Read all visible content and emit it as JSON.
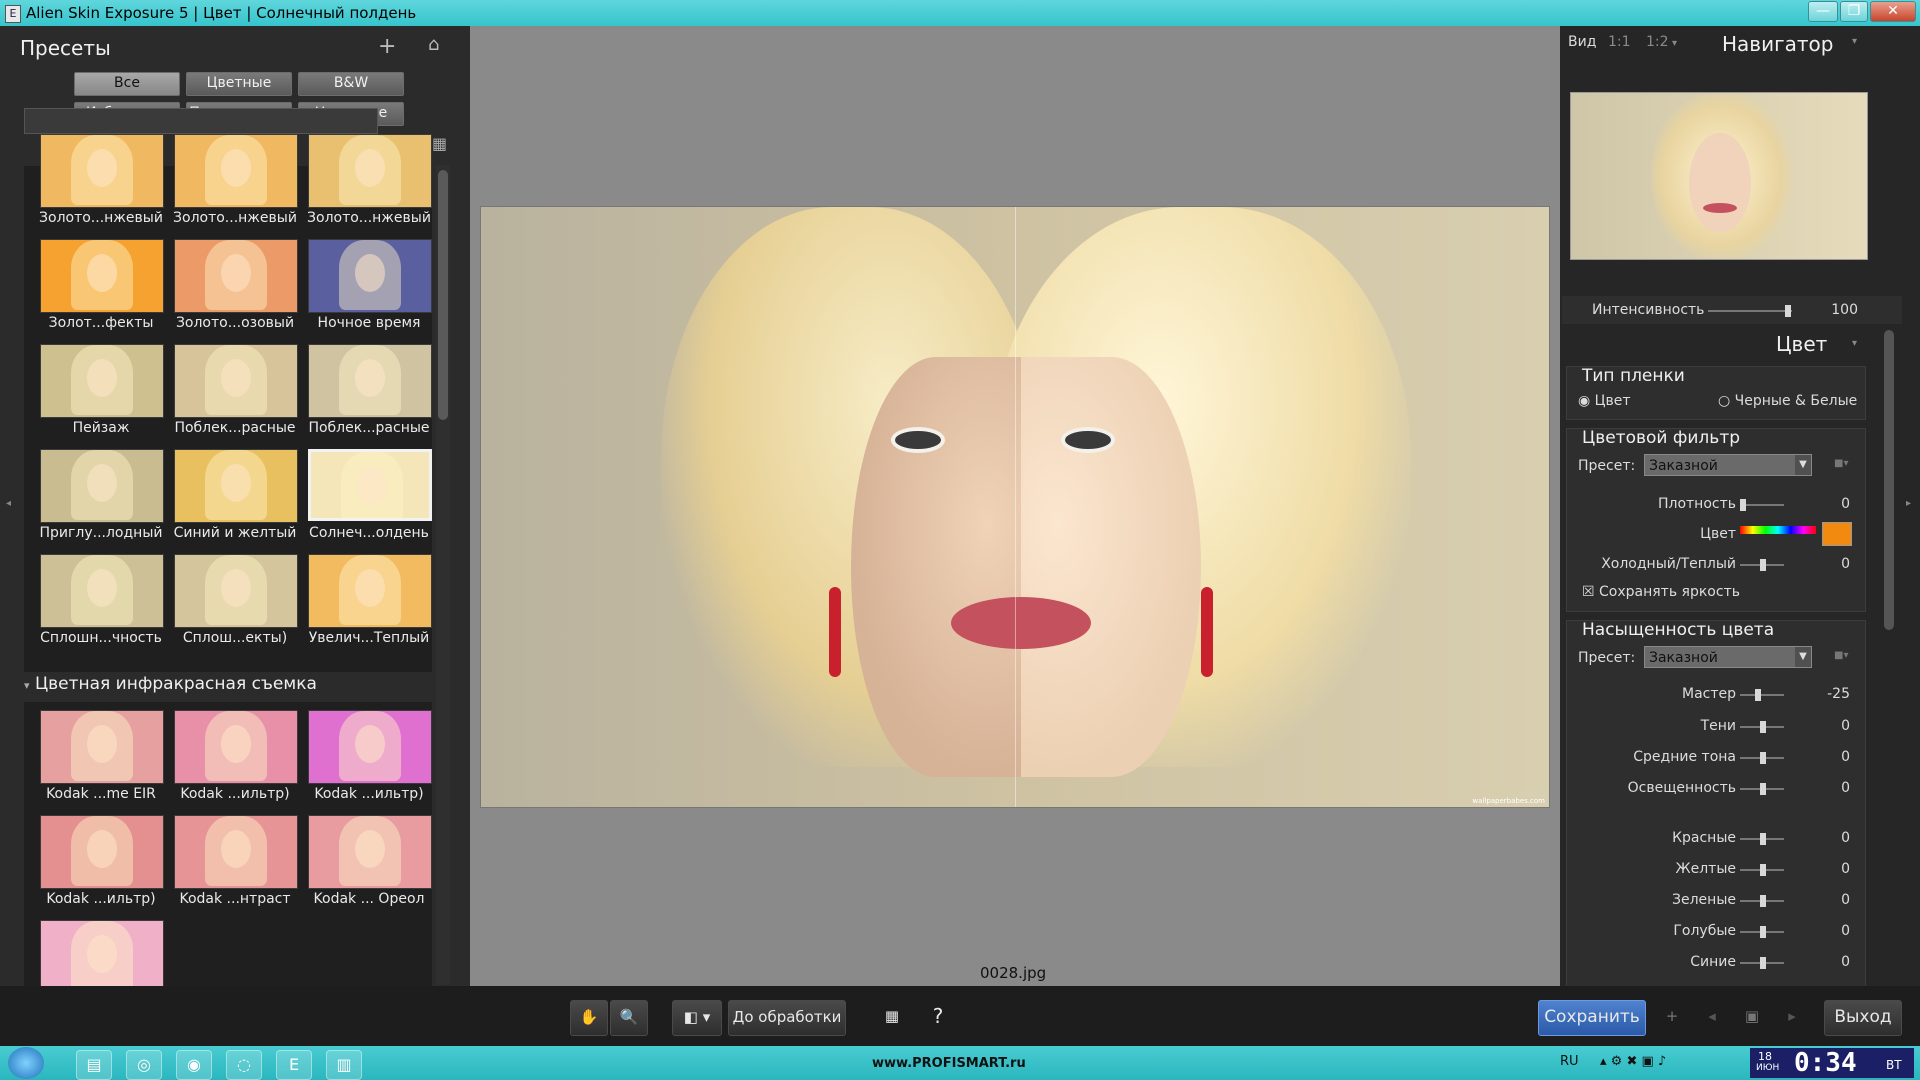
{
  "window": {
    "title": "Alien Skin Exposure 5 | Цвет | Солнечный полдень"
  },
  "presets_panel": {
    "title": "Пресеты",
    "filters": [
      "Все",
      "Цветные",
      "B&W",
      "Избранные",
      "Пользовател:",
      "Недавние"
    ],
    "active_filter": "Все",
    "search_placeholder": "",
    "groups": [
      {
        "items": [
          "Золото...нжевый",
          "Золото...нжевый",
          "Золото...нжевый",
          "Золот...фекты",
          "Золото...озовый",
          "Ночное время",
          "Пейзаж",
          "Поблек...расные",
          "Поблек...расные",
          "Приглу...лодный",
          "Синий и желтый",
          "Солнеч...олдень",
          "Сплошн...чность",
          "Сплош...екты)",
          "Увелич...Теплый"
        ]
      },
      {
        "header": "Цветная инфракрасная съемка",
        "items": [
          "Kodak ...me EIR",
          "Kodak ...ильтр)",
          "Kodak ...ильтр)",
          "Kodak ...ильтр)",
          "Kodak ...нтраст",
          "Kodak ... Ореол",
          ""
        ]
      }
    ]
  },
  "canvas": {
    "filename": "0028.jpg",
    "watermark": "wallpaperbabes.com"
  },
  "navigator": {
    "view_label": "Вид",
    "zoom_1_1": "1:1",
    "zoom_1_2": "1:2",
    "title": "Навигатор"
  },
  "intensity": {
    "label": "Интенсивность",
    "value": "100",
    "fraction": 0.95
  },
  "color_panel": {
    "title": "Цвет",
    "film_type": {
      "title": "Тип пленки",
      "options": [
        "Цвет",
        "Черные & Белые"
      ],
      "selected": "Цвет"
    },
    "color_filter": {
      "title": "Цветовой фильтр",
      "preset_label": "Пресет:",
      "preset_value": "Заказной",
      "density_label": "Плотность",
      "density_value": "0",
      "color_label": "Цвет",
      "swatch_color": "#f28a10",
      "cold_warm_label": "Холодный/Теплый",
      "cold_warm_value": "0",
      "keep_brightness": "Сохранять яркость"
    },
    "saturation": {
      "title": "Насыщенность цвета",
      "preset_label": "Пресет:",
      "preset_value": "Заказной",
      "sliders": [
        {
          "label": "Мастер",
          "value": "-25"
        },
        {
          "label": "Тени",
          "value": "0"
        },
        {
          "label": "Средние тона",
          "value": "0"
        },
        {
          "label": "Освещенность",
          "value": "0"
        },
        {
          "label": "Красные",
          "value": "0"
        },
        {
          "label": "Желтые",
          "value": "0"
        },
        {
          "label": "Зеленые",
          "value": "0"
        },
        {
          "label": "Голубые",
          "value": "0"
        },
        {
          "label": "Синие",
          "value": "0"
        }
      ]
    }
  },
  "toolbar": {
    "before_label": "До обработки",
    "save_label": "Сохранить",
    "exit_label": "Выход"
  },
  "taskbar": {
    "watermark": "www.PROFISMART.ru",
    "lang": "RU",
    "time": "0:34",
    "date_day": "18",
    "date_mon": "ИЮН",
    "weekday": "ВТ"
  },
  "colors": {
    "accent": "#2a5aa8",
    "titlebar": "#37c4cc"
  }
}
